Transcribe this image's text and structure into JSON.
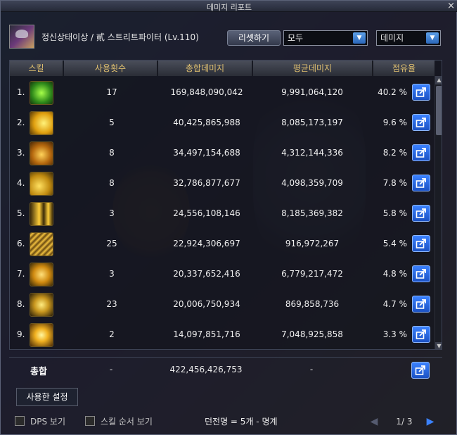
{
  "window": {
    "title": "데미지 리포트",
    "close_label": "×"
  },
  "header": {
    "character": "정신상태이상 / 貳 스트리트파이터 (Lv.110)",
    "reset_label": "리셋하기",
    "filter_select": "모두",
    "metric_select": "데미지"
  },
  "table": {
    "columns": [
      "스킬",
      "사용횟수",
      "총합데미지",
      "평균데미지",
      "점유율"
    ],
    "rows": [
      {
        "idx": "1.",
        "uses": "17",
        "total": "169,848,090,042",
        "avg": "9,991,064,120",
        "share": "40.2 %"
      },
      {
        "idx": "2.",
        "uses": "5",
        "total": "40,425,865,988",
        "avg": "8,085,173,197",
        "share": "9.6 %"
      },
      {
        "idx": "3.",
        "uses": "8",
        "total": "34,497,154,688",
        "avg": "4,312,144,336",
        "share": "8.2 %"
      },
      {
        "idx": "4.",
        "uses": "8",
        "total": "32,786,877,677",
        "avg": "4,098,359,709",
        "share": "7.8 %"
      },
      {
        "idx": "5.",
        "uses": "3",
        "total": "24,556,108,146",
        "avg": "8,185,369,382",
        "share": "5.8 %"
      },
      {
        "idx": "6.",
        "uses": "25",
        "total": "22,924,306,697",
        "avg": "916,972,267",
        "share": "5.4 %"
      },
      {
        "idx": "7.",
        "uses": "3",
        "total": "20,337,652,416",
        "avg": "6,779,217,472",
        "share": "4.8 %"
      },
      {
        "idx": "8.",
        "uses": "23",
        "total": "20,006,750,934",
        "avg": "869,858,736",
        "share": "4.7 %"
      },
      {
        "idx": "9.",
        "uses": "2",
        "total": "14,097,851,716",
        "avg": "7,048,925,858",
        "share": "3.3 %"
      }
    ],
    "total": {
      "label": "총합",
      "uses": "-",
      "total": "422,456,426,753",
      "avg": "-"
    }
  },
  "settings_tab": "사용한 설정",
  "footer": {
    "dps_label": "DPS 보기",
    "skill_order_label": "스킬 순서 보기",
    "dungeon_info": "던전명 = 5개 - 명계",
    "page_text": "1/ 3"
  },
  "icons": {
    "skill_icons": [
      "skill-icon-1",
      "skill-icon-2",
      "skill-icon-3",
      "skill-icon-4",
      "skill-icon-5",
      "skill-icon-6",
      "skill-icon-7",
      "skill-icon-8",
      "skill-icon-9"
    ],
    "share": "share-icon",
    "prev": "prev-arrow-icon",
    "next": "next-arrow-icon"
  },
  "colors": {
    "accent_blue": "#3b82ff",
    "header_gold": "#e0c070"
  }
}
